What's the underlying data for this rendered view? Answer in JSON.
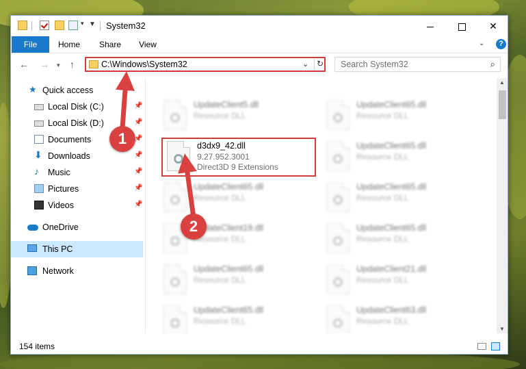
{
  "window": {
    "title": "System32",
    "buttons": {
      "minimize": "minimize",
      "maximize": "maximize",
      "close": "✕"
    }
  },
  "ribbon": {
    "tabs": [
      "File",
      "Home",
      "Share",
      "View"
    ],
    "help": "?"
  },
  "navigation": {
    "address": "C:\\Windows\\System32",
    "search_placeholder": "Search System32"
  },
  "sidebar": {
    "items": [
      {
        "label": "Quick access",
        "icon": "star-icon",
        "pinned": false
      },
      {
        "label": "Local Disk (C:)",
        "icon": "disk-icon",
        "pinned": true
      },
      {
        "label": "Local Disk (D:)",
        "icon": "disk-icon",
        "pinned": true
      },
      {
        "label": "Documents",
        "icon": "document-icon",
        "pinned": true
      },
      {
        "label": "Downloads",
        "icon": "download-icon",
        "pinned": true
      },
      {
        "label": "Music",
        "icon": "music-icon",
        "pinned": true
      },
      {
        "label": "Pictures",
        "icon": "picture-icon",
        "pinned": true
      },
      {
        "label": "Videos",
        "icon": "video-icon",
        "pinned": true
      },
      {
        "label": "OneDrive",
        "icon": "cloud-icon",
        "pinned": false
      },
      {
        "label": "This PC",
        "icon": "computer-icon",
        "pinned": false,
        "selected": true
      },
      {
        "label": "Network",
        "icon": "network-icon",
        "pinned": false
      }
    ]
  },
  "files": {
    "left": [
      {
        "name": "UpdateClient5.dll",
        "line1": "Resource DLL",
        "line2": "",
        "blurred": true
      },
      {
        "name": "d3dx9_42.dll",
        "line1": "9.27.952.3001",
        "line2": "Direct3D 9 Extensions",
        "blurred": false,
        "highlighted": true
      },
      {
        "name": "UpdateClient65.dll",
        "line1": "Resource DLL",
        "line2": "",
        "blurred": true
      },
      {
        "name": "UpdateClient19.dll",
        "line1": "Resource DLL",
        "line2": "",
        "blurred": true
      },
      {
        "name": "UpdateClient65.dll",
        "line1": "Resource DLL",
        "line2": "",
        "blurred": true
      },
      {
        "name": "UpdateClient65.dll",
        "line1": "Resource DLL",
        "line2": "",
        "blurred": true
      }
    ],
    "right": [
      {
        "name": "UpdateClient65.dll",
        "line1": "Resource DLL"
      },
      {
        "name": "UpdateClient65.dll",
        "line1": "Resource DLL"
      },
      {
        "name": "UpdateClient65.dll",
        "line1": "Resource DLL"
      },
      {
        "name": "UpdateClient65.dll",
        "line1": "Resource DLL"
      },
      {
        "name": "UpdateClient21.dll",
        "line1": "Resource DLL"
      },
      {
        "name": "UpdateClient63.dll",
        "line1": "Resource DLL"
      }
    ]
  },
  "status": {
    "item_count": "154 items"
  },
  "annotations": {
    "step1": "1",
    "step2": "2",
    "color": "#d94141"
  },
  "colors": {
    "accent": "#1979ca",
    "highlight_border": "#d63b3b",
    "selected_bg": "#cce8ff"
  }
}
